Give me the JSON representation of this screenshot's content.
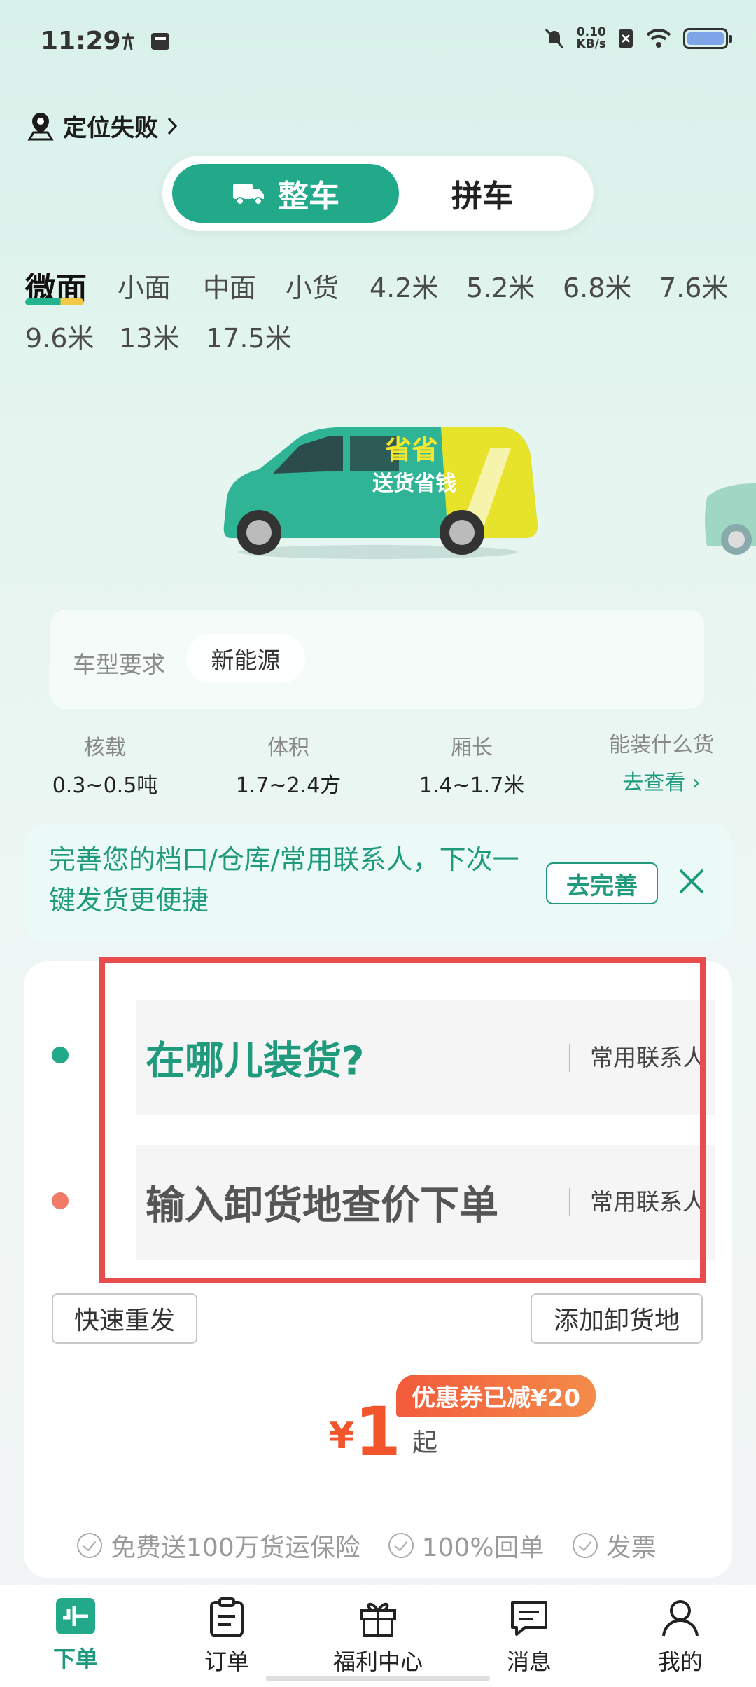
{
  "status_bar": {
    "time": "11:29",
    "netspeed_value": "0.10",
    "netspeed_unit": "KB/s"
  },
  "location": {
    "label": "定位失败",
    "icon": "location-pin-icon"
  },
  "mode_switch": {
    "active": "整车",
    "inactive": "拼车"
  },
  "vehicle_tabs": [
    "微面",
    "小面",
    "中面",
    "小货",
    "4.2米",
    "5.2米",
    "6.8米",
    "7.6米",
    "9.6米",
    "13米",
    "17.5米"
  ],
  "vehicle_image": {
    "logo_text": "省省",
    "slogan": "送货省钱"
  },
  "requirement": {
    "label": "车型要求",
    "chip": "新能源"
  },
  "specs": [
    {
      "key": "核载",
      "value": "0.3~0.5吨"
    },
    {
      "key": "体积",
      "value": "1.7~2.4方"
    },
    {
      "key": "厢长",
      "value": "1.4~1.7米"
    }
  ],
  "cargo_link": {
    "key": "能装什么货",
    "link": "去查看 ›"
  },
  "banner": {
    "text": "完善您的档口/仓库/常用联系人，下次一键发货更便捷",
    "button": "去完善"
  },
  "order": {
    "pickup_placeholder": "在哪儿装货?",
    "dropoff_placeholder": "输入卸货地查价下单",
    "contact_label": "常用联系人",
    "quick_resend": "快速重发",
    "add_dropoff": "添加卸货地",
    "price_currency": "¥",
    "price_value": "1",
    "price_suffix": "起",
    "coupon": "优惠券已减¥20"
  },
  "benefits": [
    "免费送100万货运保险",
    "100%回单",
    "发票"
  ],
  "bottom_nav": [
    {
      "label": "下单",
      "icon": "order-place-icon",
      "active": true
    },
    {
      "label": "订单",
      "icon": "clipboard-icon",
      "active": false
    },
    {
      "label": "福利中心",
      "icon": "gift-icon",
      "active": false
    },
    {
      "label": "消息",
      "icon": "message-icon",
      "active": false
    },
    {
      "label": "我的",
      "icon": "profile-icon",
      "active": false
    }
  ],
  "colors": {
    "brand": "#21a98a",
    "accent_orange": "#f2552c",
    "highlight_box": "#e84c4c"
  }
}
